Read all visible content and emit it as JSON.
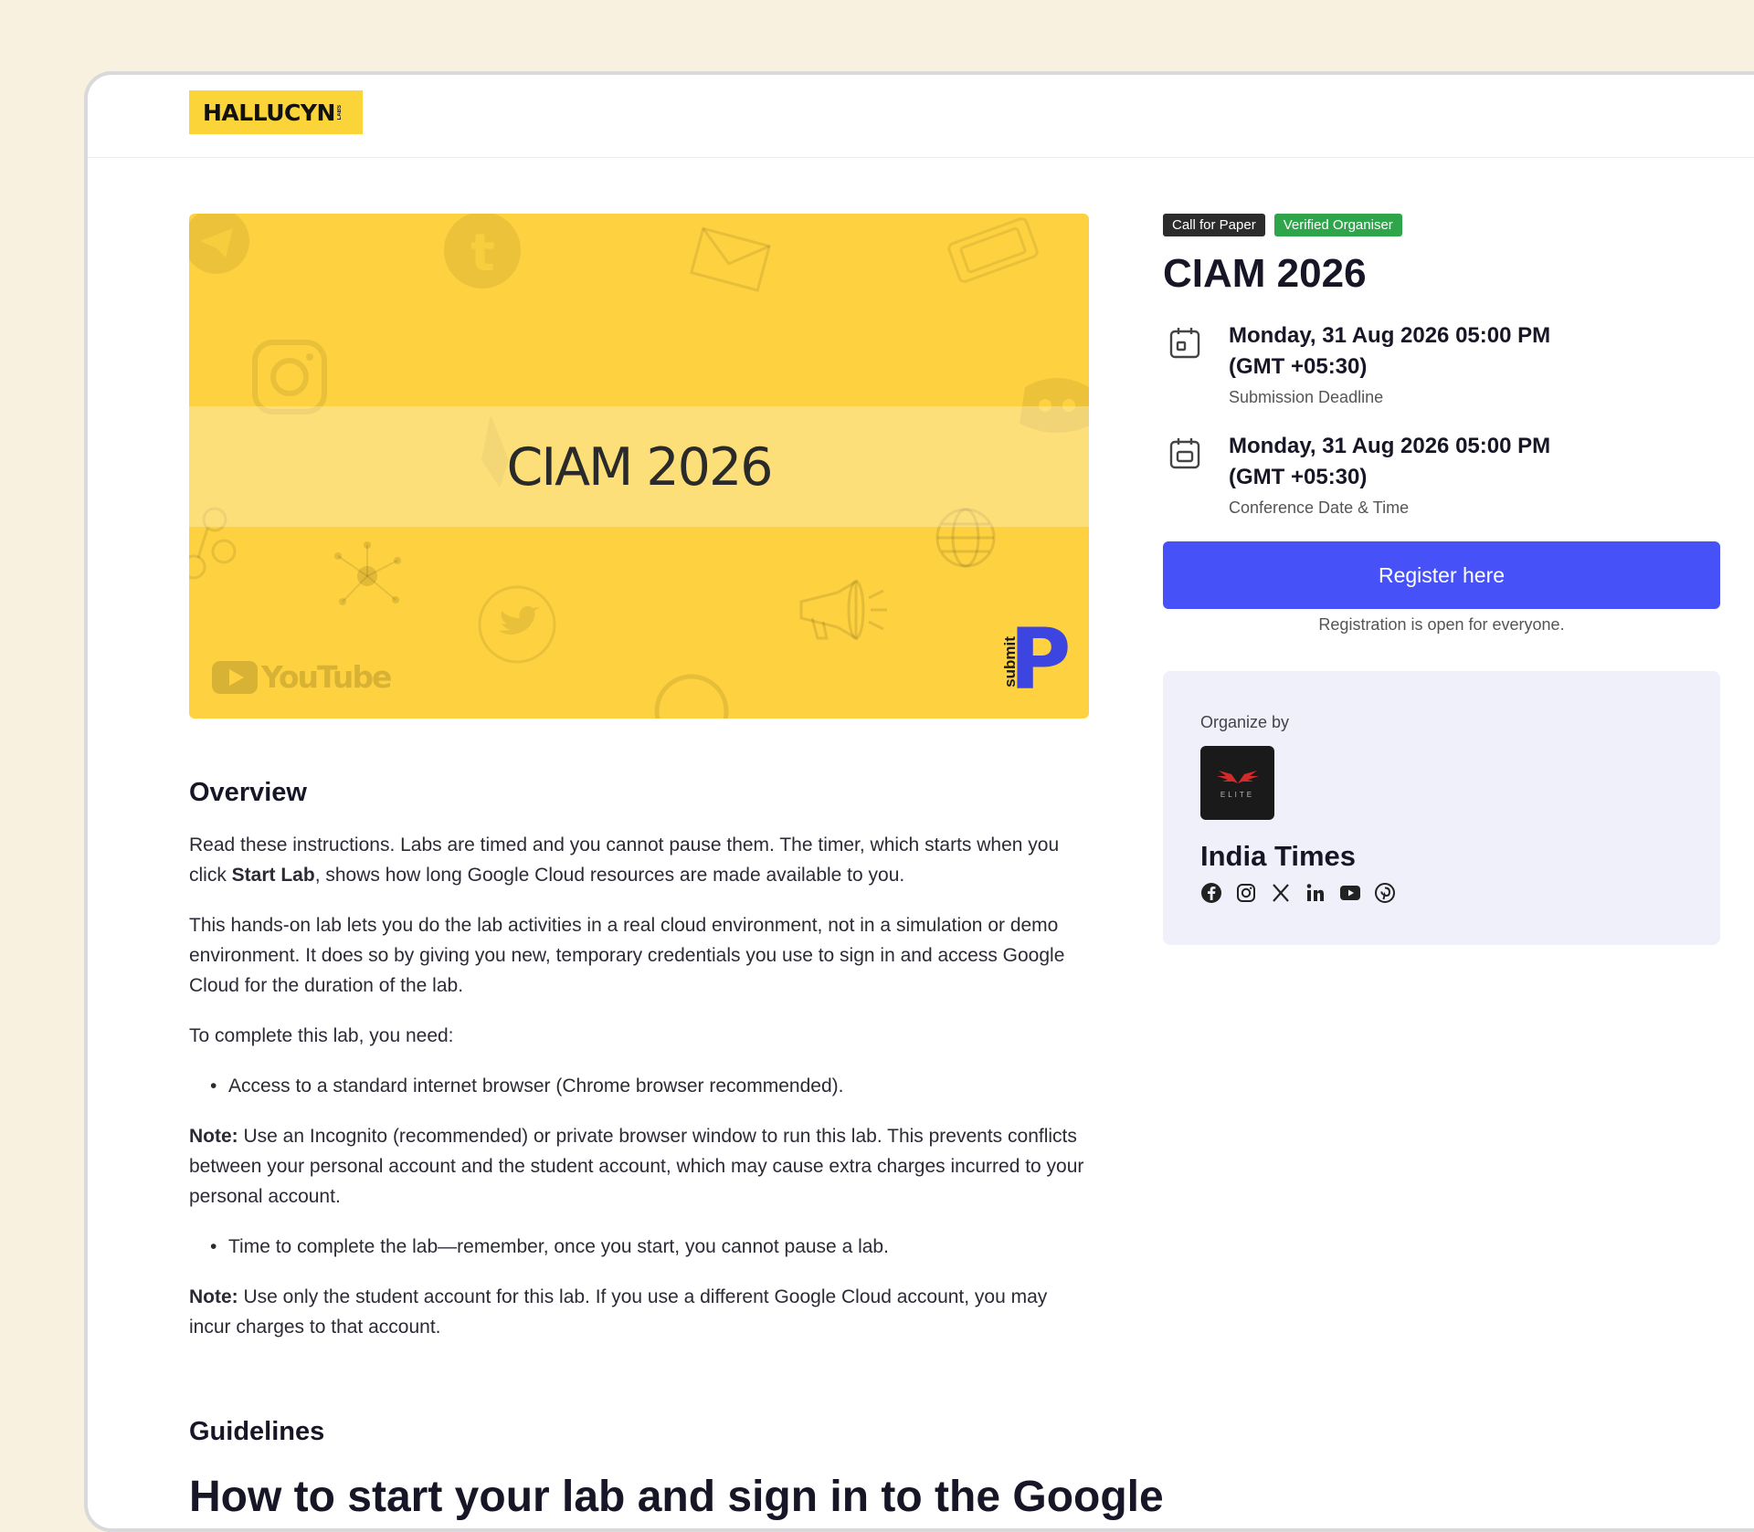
{
  "brand": {
    "logo_text": "HALLUCYN",
    "logo_sub": "LABS"
  },
  "banner": {
    "title": "CIAM 2026",
    "youtube_text": "YouTube",
    "submit_text": "submit",
    "submit_letter": "P"
  },
  "event": {
    "tags": [
      "Call for Paper",
      "Verified Organiser"
    ],
    "title": "CIAM 2026",
    "dates": [
      {
        "main": "Monday, 31 Aug 2026 05:00 PM",
        "tz": "(GMT +05:30)",
        "label": "Submission Deadline",
        "icon": "calendar-icon"
      },
      {
        "main": "Monday, 31 Aug 2026 05:00 PM",
        "tz": "(GMT +05:30)",
        "label": "Conference Date & Time",
        "icon": "calendar-icon"
      }
    ],
    "register_label": "Register here",
    "register_note": "Registration is open for everyone."
  },
  "organizer": {
    "label": "Organize by",
    "logo_text": "ELITE",
    "name": "India Times",
    "socials": [
      "facebook-icon",
      "instagram-icon",
      "x-icon",
      "linkedin-icon",
      "youtube-icon",
      "pinterest-icon"
    ]
  },
  "overview": {
    "heading": "Overview",
    "p1_a": "Read these instructions. Labs are timed and you cannot pause them. The timer, which starts when you click ",
    "p1_b": "Start Lab",
    "p1_c": ", shows how long Google Cloud resources are made available to you.",
    "p2": "This hands-on lab lets you do the lab activities in a real cloud environment, not in a simulation or demo environment. It does so by giving you new, temporary credentials you use to sign in and access Google Cloud for the duration of the lab.",
    "p3": "To complete this lab, you need:",
    "bullet1": "Access to a standard internet browser (Chrome browser recommended).",
    "note1_label": "Note:",
    "note1": " Use an Incognito (recommended) or private browser window to run this lab. This prevents conflicts between your personal account and the student account, which may cause extra charges incurred to your personal account.",
    "bullet2": "Time to complete the lab—remember, once you start, you cannot pause a lab.",
    "note2_label": "Note:",
    "note2": " Use only the student account for this lab. If you use a different Google Cloud account, you may incur charges to that account."
  },
  "guidelines": {
    "heading": "Guidelines",
    "subheading": "How to start your lab and sign in to the Google"
  },
  "colors": {
    "accent": "#4652f7",
    "banner": "#fdd13f",
    "verified": "#2fa54b",
    "card": "#f0f0fb"
  }
}
